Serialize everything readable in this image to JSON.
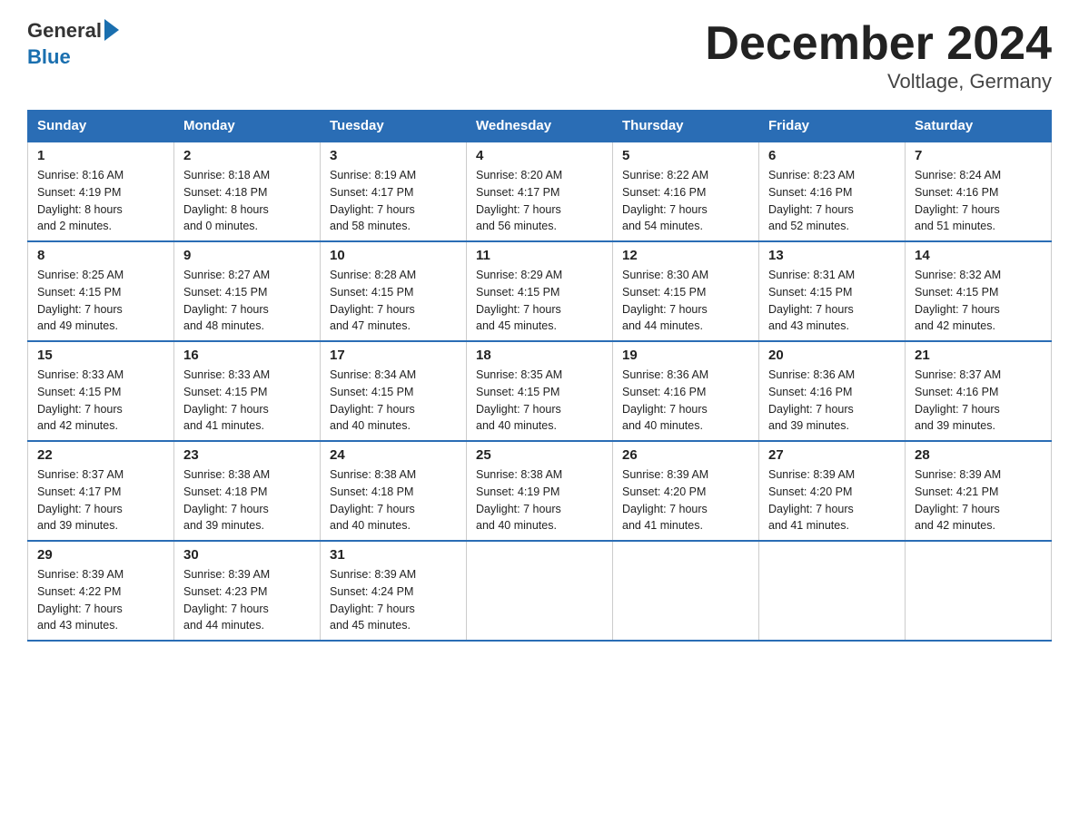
{
  "header": {
    "logo_general": "General",
    "logo_blue": "Blue",
    "title": "December 2024",
    "subtitle": "Voltlage, Germany"
  },
  "days_of_week": [
    "Sunday",
    "Monday",
    "Tuesday",
    "Wednesday",
    "Thursday",
    "Friday",
    "Saturday"
  ],
  "weeks": [
    [
      {
        "day": "1",
        "sunrise": "8:16 AM",
        "sunset": "4:19 PM",
        "daylight": "8 hours and 2 minutes."
      },
      {
        "day": "2",
        "sunrise": "8:18 AM",
        "sunset": "4:18 PM",
        "daylight": "8 hours and 0 minutes."
      },
      {
        "day": "3",
        "sunrise": "8:19 AM",
        "sunset": "4:17 PM",
        "daylight": "7 hours and 58 minutes."
      },
      {
        "day": "4",
        "sunrise": "8:20 AM",
        "sunset": "4:17 PM",
        "daylight": "7 hours and 56 minutes."
      },
      {
        "day": "5",
        "sunrise": "8:22 AM",
        "sunset": "4:16 PM",
        "daylight": "7 hours and 54 minutes."
      },
      {
        "day": "6",
        "sunrise": "8:23 AM",
        "sunset": "4:16 PM",
        "daylight": "7 hours and 52 minutes."
      },
      {
        "day": "7",
        "sunrise": "8:24 AM",
        "sunset": "4:16 PM",
        "daylight": "7 hours and 51 minutes."
      }
    ],
    [
      {
        "day": "8",
        "sunrise": "8:25 AM",
        "sunset": "4:15 PM",
        "daylight": "7 hours and 49 minutes."
      },
      {
        "day": "9",
        "sunrise": "8:27 AM",
        "sunset": "4:15 PM",
        "daylight": "7 hours and 48 minutes."
      },
      {
        "day": "10",
        "sunrise": "8:28 AM",
        "sunset": "4:15 PM",
        "daylight": "7 hours and 47 minutes."
      },
      {
        "day": "11",
        "sunrise": "8:29 AM",
        "sunset": "4:15 PM",
        "daylight": "7 hours and 45 minutes."
      },
      {
        "day": "12",
        "sunrise": "8:30 AM",
        "sunset": "4:15 PM",
        "daylight": "7 hours and 44 minutes."
      },
      {
        "day": "13",
        "sunrise": "8:31 AM",
        "sunset": "4:15 PM",
        "daylight": "7 hours and 43 minutes."
      },
      {
        "day": "14",
        "sunrise": "8:32 AM",
        "sunset": "4:15 PM",
        "daylight": "7 hours and 42 minutes."
      }
    ],
    [
      {
        "day": "15",
        "sunrise": "8:33 AM",
        "sunset": "4:15 PM",
        "daylight": "7 hours and 42 minutes."
      },
      {
        "day": "16",
        "sunrise": "8:33 AM",
        "sunset": "4:15 PM",
        "daylight": "7 hours and 41 minutes."
      },
      {
        "day": "17",
        "sunrise": "8:34 AM",
        "sunset": "4:15 PM",
        "daylight": "7 hours and 40 minutes."
      },
      {
        "day": "18",
        "sunrise": "8:35 AM",
        "sunset": "4:15 PM",
        "daylight": "7 hours and 40 minutes."
      },
      {
        "day": "19",
        "sunrise": "8:36 AM",
        "sunset": "4:16 PM",
        "daylight": "7 hours and 40 minutes."
      },
      {
        "day": "20",
        "sunrise": "8:36 AM",
        "sunset": "4:16 PM",
        "daylight": "7 hours and 39 minutes."
      },
      {
        "day": "21",
        "sunrise": "8:37 AM",
        "sunset": "4:16 PM",
        "daylight": "7 hours and 39 minutes."
      }
    ],
    [
      {
        "day": "22",
        "sunrise": "8:37 AM",
        "sunset": "4:17 PM",
        "daylight": "7 hours and 39 minutes."
      },
      {
        "day": "23",
        "sunrise": "8:38 AM",
        "sunset": "4:18 PM",
        "daylight": "7 hours and 39 minutes."
      },
      {
        "day": "24",
        "sunrise": "8:38 AM",
        "sunset": "4:18 PM",
        "daylight": "7 hours and 40 minutes."
      },
      {
        "day": "25",
        "sunrise": "8:38 AM",
        "sunset": "4:19 PM",
        "daylight": "7 hours and 40 minutes."
      },
      {
        "day": "26",
        "sunrise": "8:39 AM",
        "sunset": "4:20 PM",
        "daylight": "7 hours and 41 minutes."
      },
      {
        "day": "27",
        "sunrise": "8:39 AM",
        "sunset": "4:20 PM",
        "daylight": "7 hours and 41 minutes."
      },
      {
        "day": "28",
        "sunrise": "8:39 AM",
        "sunset": "4:21 PM",
        "daylight": "7 hours and 42 minutes."
      }
    ],
    [
      {
        "day": "29",
        "sunrise": "8:39 AM",
        "sunset": "4:22 PM",
        "daylight": "7 hours and 43 minutes."
      },
      {
        "day": "30",
        "sunrise": "8:39 AM",
        "sunset": "4:23 PM",
        "daylight": "7 hours and 44 minutes."
      },
      {
        "day": "31",
        "sunrise": "8:39 AM",
        "sunset": "4:24 PM",
        "daylight": "7 hours and 45 minutes."
      },
      null,
      null,
      null,
      null
    ]
  ],
  "labels": {
    "sunrise": "Sunrise:",
    "sunset": "Sunset:",
    "daylight": "Daylight:"
  }
}
